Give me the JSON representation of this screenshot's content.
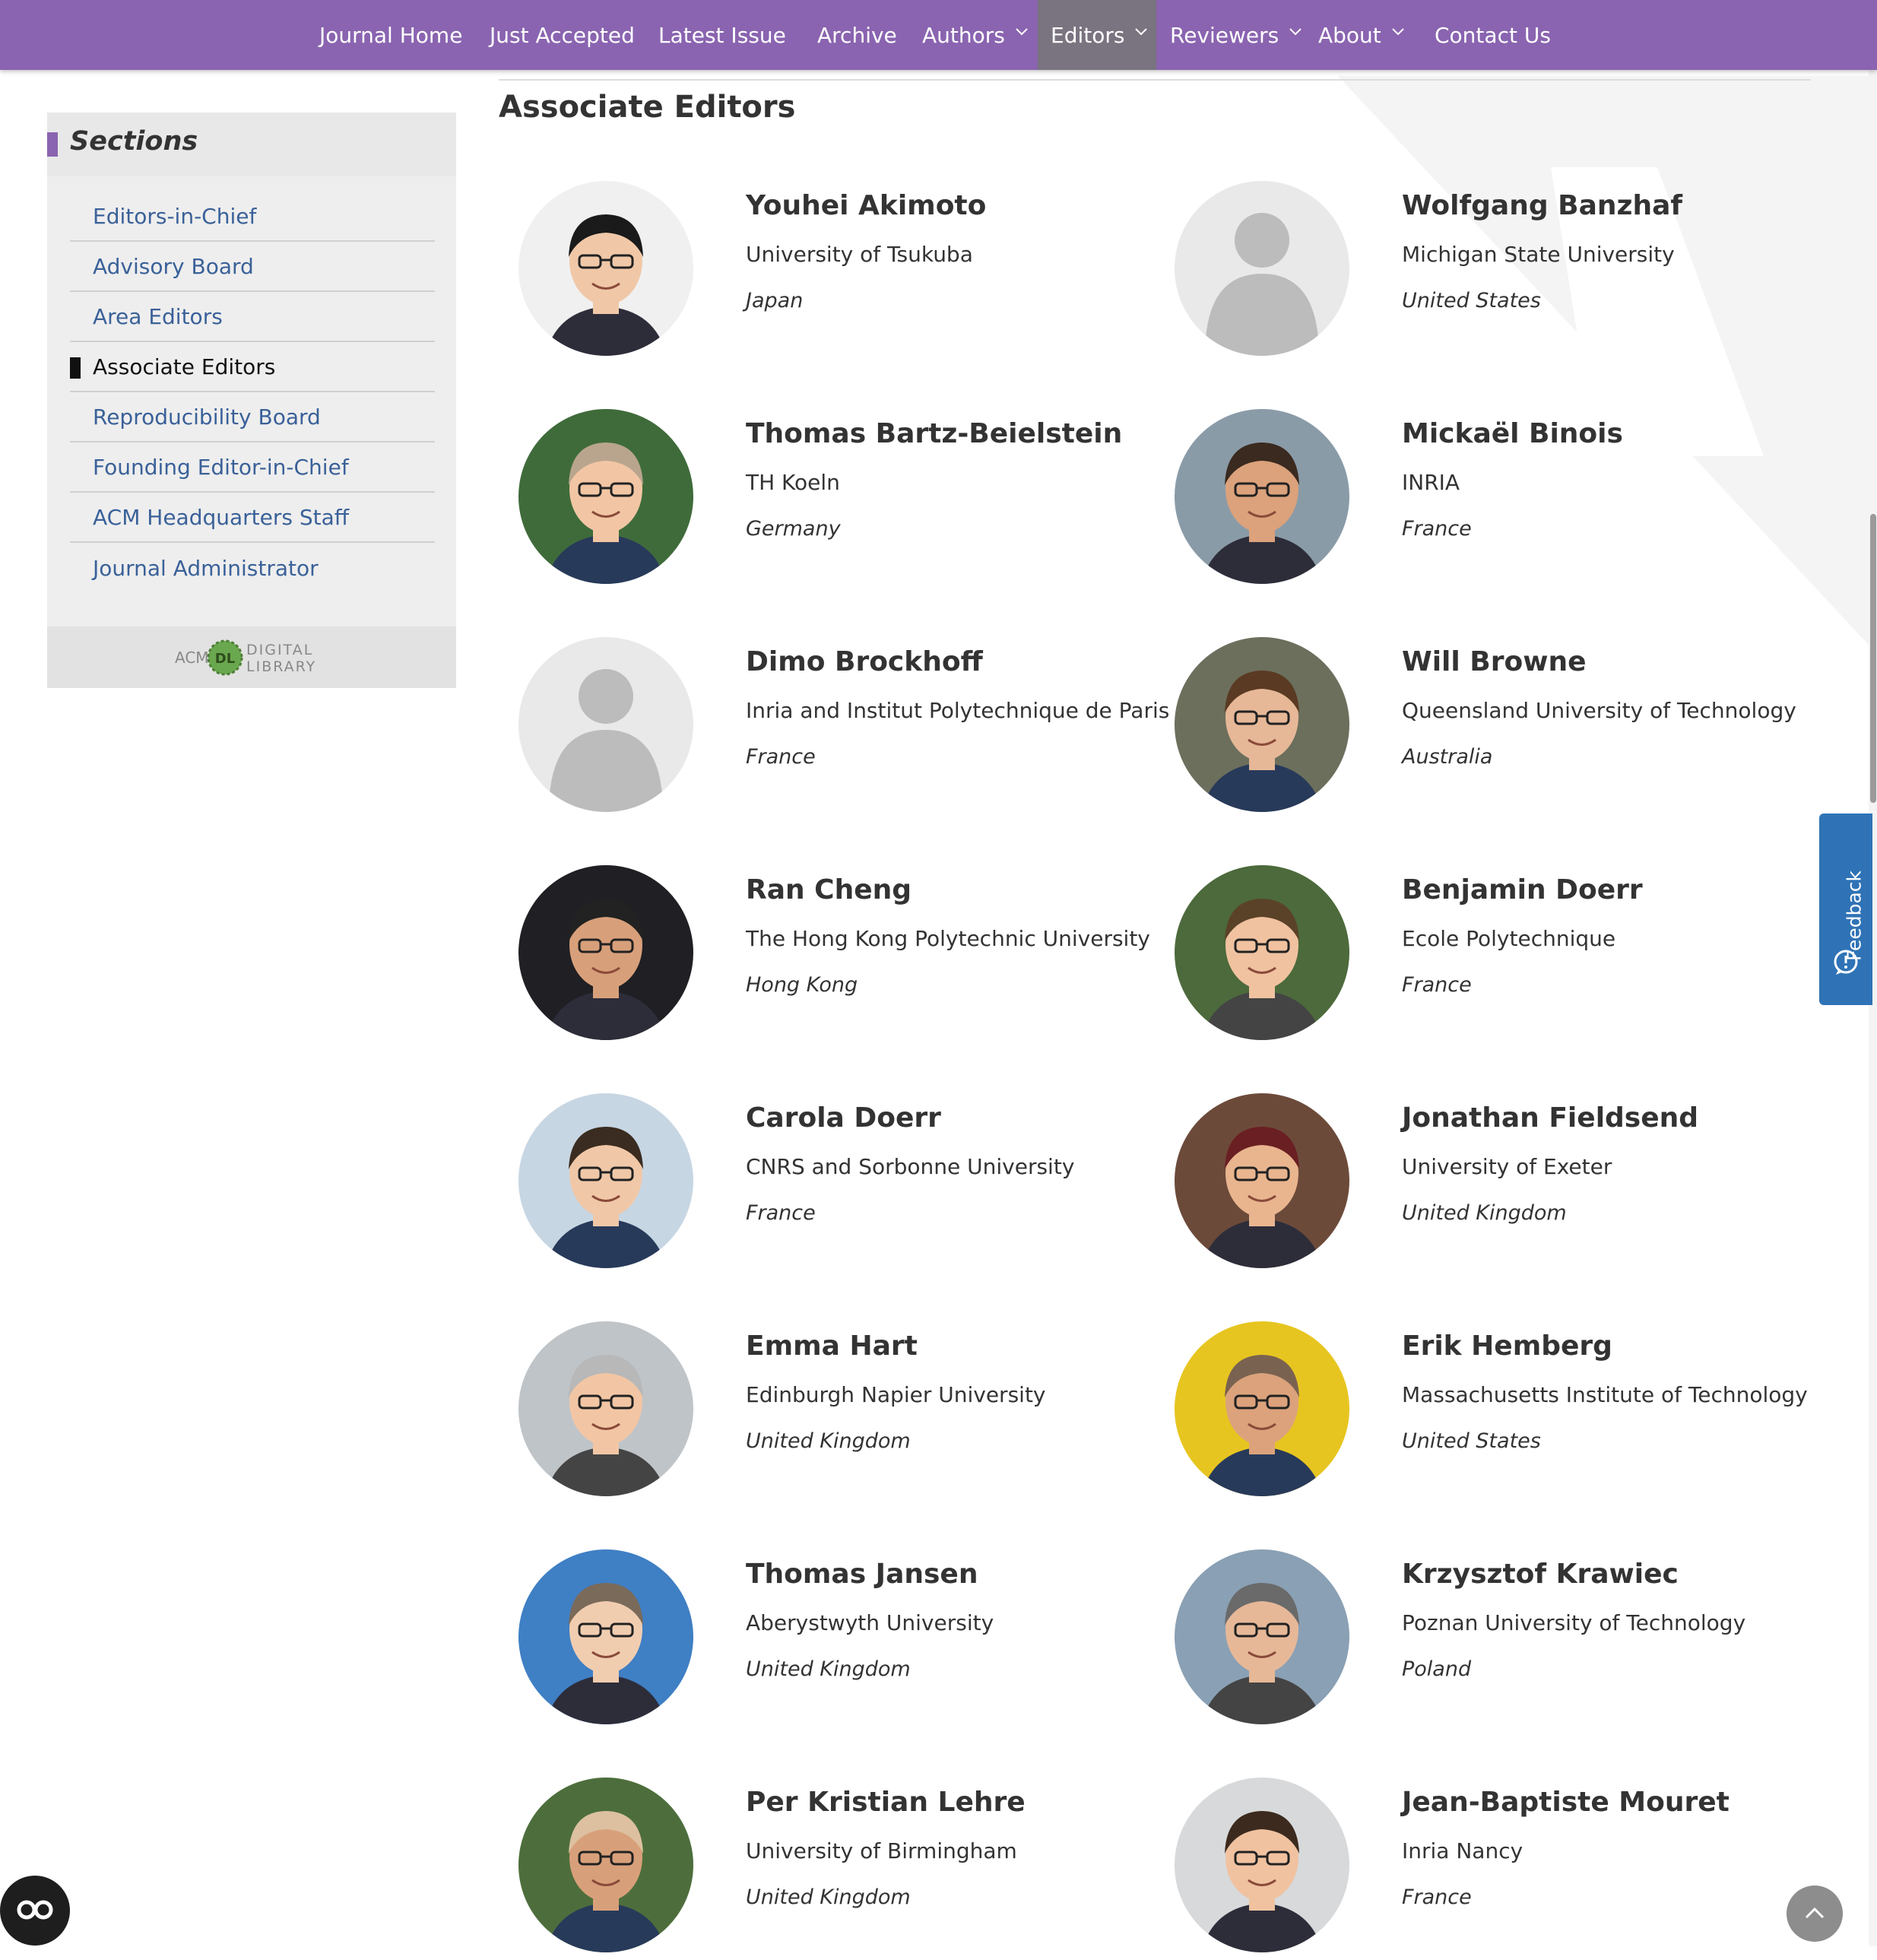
{
  "nav": {
    "items": [
      {
        "label": "Journal Home",
        "dropdown": false,
        "active": false
      },
      {
        "label": "Just Accepted",
        "dropdown": false,
        "active": false
      },
      {
        "label": "Latest Issue",
        "dropdown": false,
        "active": false
      },
      {
        "label": "Archive",
        "dropdown": false,
        "active": false
      },
      {
        "label": "Authors",
        "dropdown": true,
        "active": false
      },
      {
        "label": "Editors",
        "dropdown": true,
        "active": true
      },
      {
        "label": "Reviewers",
        "dropdown": true,
        "active": false
      },
      {
        "label": "About",
        "dropdown": true,
        "active": false
      },
      {
        "label": "Contact Us",
        "dropdown": false,
        "active": false
      }
    ],
    "color": "#8a64b0"
  },
  "sidebar": {
    "title": "Sections",
    "items": [
      {
        "label": "Editors-in-Chief",
        "current": false
      },
      {
        "label": "Advisory Board",
        "current": false
      },
      {
        "label": "Area Editors",
        "current": false
      },
      {
        "label": "Associate Editors",
        "current": true
      },
      {
        "label": "Reproducibility Board",
        "current": false
      },
      {
        "label": "Founding Editor-in-Chief",
        "current": false
      },
      {
        "label": "ACM Headquarters Staff",
        "current": false
      },
      {
        "label": "Journal Administrator",
        "current": false
      }
    ],
    "logo": {
      "acm": "ACM",
      "dl": "DL",
      "line1": "DIGITAL",
      "line2": "LIBRARY"
    }
  },
  "main": {
    "title": "Associate Editors",
    "editors": [
      {
        "name": "Youhei Akimoto",
        "affiliation": "University of Tsukuba",
        "country": "Japan",
        "photo": true
      },
      {
        "name": "Wolfgang Banzhaf",
        "affiliation": "Michigan State University",
        "country": "United States",
        "photo": false
      },
      {
        "name": "Thomas Bartz-Beielstein",
        "affiliation": "TH Koeln",
        "country": "Germany",
        "photo": true
      },
      {
        "name": "Mickaël Binois",
        "affiliation": "INRIA",
        "country": "France",
        "photo": true
      },
      {
        "name": "Dimo Brockhoff",
        "affiliation": "Inria and Institut Polytechnique de Paris",
        "country": "France",
        "photo": false
      },
      {
        "name": "Will Browne",
        "affiliation": "Queensland University of Technology",
        "country": "Australia",
        "photo": true
      },
      {
        "name": "Ran Cheng",
        "affiliation": "The Hong Kong Polytechnic University",
        "country": "Hong Kong",
        "photo": true
      },
      {
        "name": "Benjamin Doerr",
        "affiliation": "Ecole Polytechnique",
        "country": "France",
        "photo": true
      },
      {
        "name": "Carola Doerr",
        "affiliation": "CNRS and Sorbonne University",
        "country": "France",
        "photo": true
      },
      {
        "name": "Jonathan Fieldsend",
        "affiliation": "University of Exeter",
        "country": "United Kingdom",
        "photo": true
      },
      {
        "name": "Emma Hart",
        "affiliation": "Edinburgh Napier University",
        "country": "United Kingdom",
        "photo": true
      },
      {
        "name": "Erik Hemberg",
        "affiliation": "Massachusetts Institute of Technology",
        "country": "United States",
        "photo": true
      },
      {
        "name": "Thomas Jansen",
        "affiliation": "Aberystwyth University",
        "country": "United Kingdom",
        "photo": true
      },
      {
        "name": "Krzysztof Krawiec",
        "affiliation": "Poznan University of Technology",
        "country": "Poland",
        "photo": true
      },
      {
        "name": "Per Kristian Lehre",
        "affiliation": "University of Birmingham",
        "country": "United Kingdom",
        "photo": true
      },
      {
        "name": "Jean-Baptiste Mouret",
        "affiliation": "Inria Nancy",
        "country": "France",
        "photo": true
      }
    ]
  },
  "feedback": {
    "label": "Feedback"
  },
  "icons": {
    "accessibility": "accessibility-icon",
    "back_to_top": "chevron-up-icon",
    "feedback": "chat-bubble-icon",
    "placeholder_avatar": "person-silhouette-icon"
  }
}
